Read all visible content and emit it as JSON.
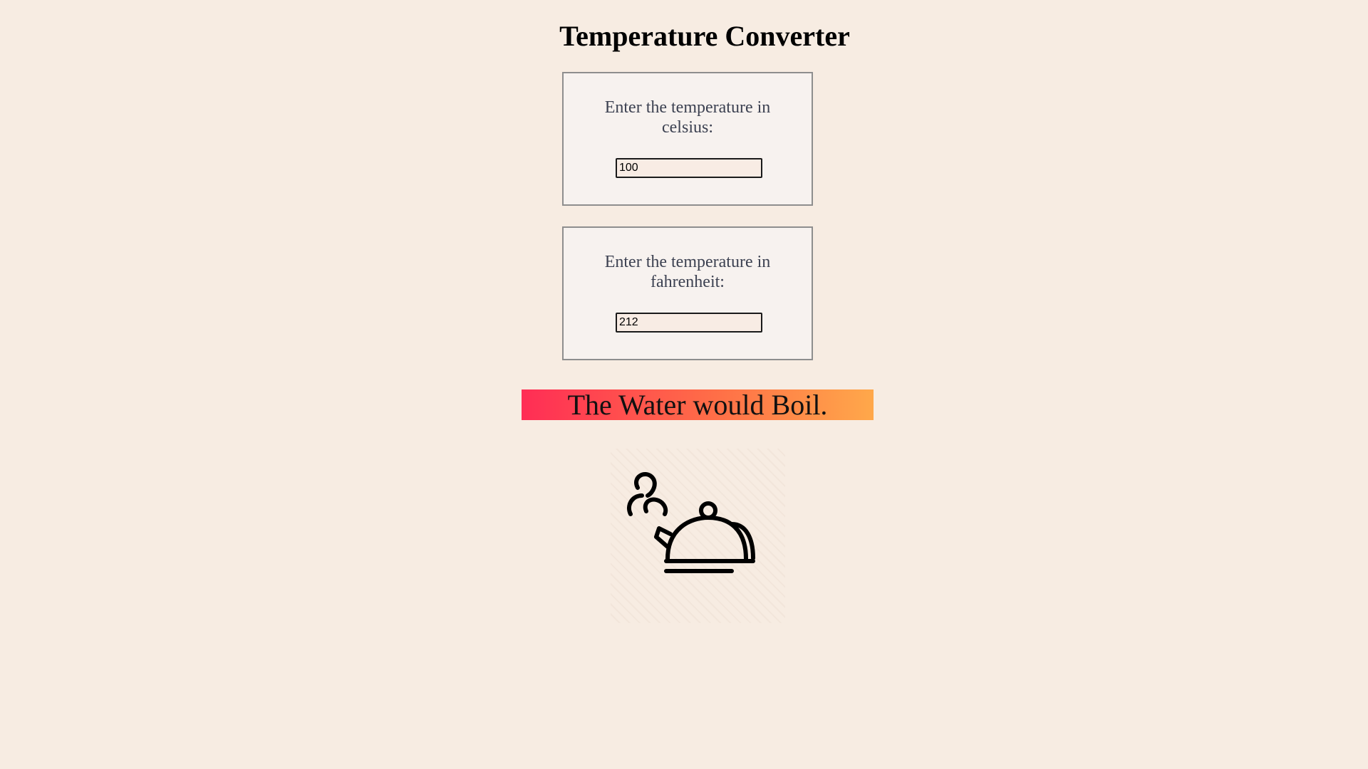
{
  "page": {
    "title": "Temperature Converter"
  },
  "celsius": {
    "label": "Enter the temperature in celsius:",
    "value": "100"
  },
  "fahrenheit": {
    "label": "Enter the temperature in fahrenheit:",
    "value": "212"
  },
  "result": {
    "message": "The Water would Boil.",
    "gradient_colors": [
      "#ff2d55",
      "#ffa84a"
    ]
  },
  "illustration": {
    "icon": "boiling-kettle-icon"
  },
  "colors": {
    "background": "#f7ece2",
    "card_background": "#f7f2ef",
    "label_text": "#3c4151"
  }
}
